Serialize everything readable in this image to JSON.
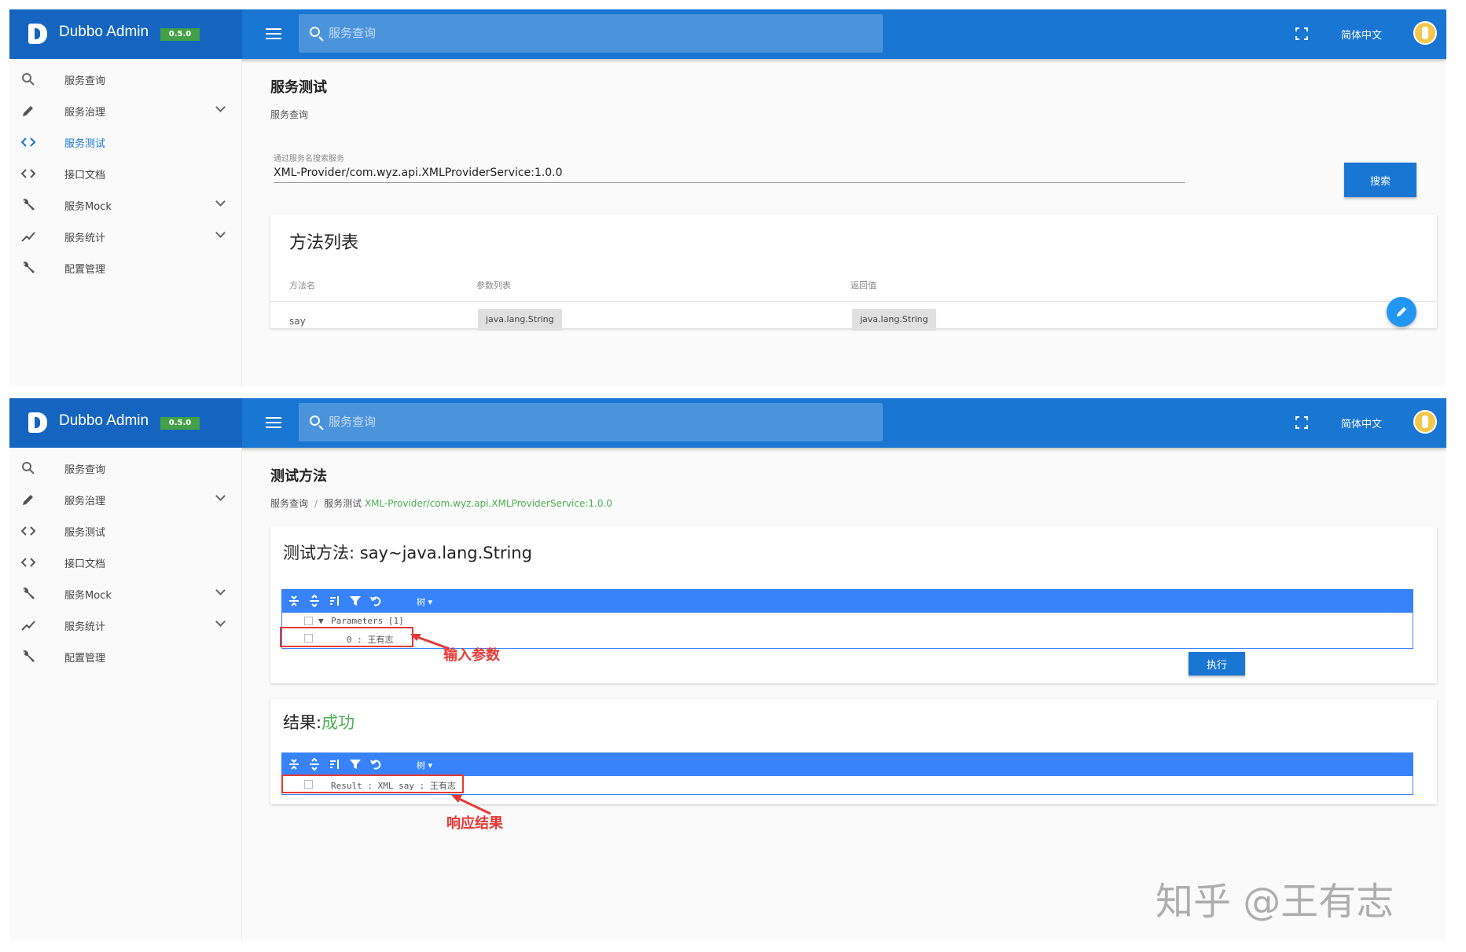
{
  "app": {
    "title": "Dubbo Admin",
    "version": "0.5.0"
  },
  "header": {
    "search_placeholder": "服务查询",
    "language": "简体中文"
  },
  "sidebar": {
    "items": [
      {
        "label": "服务查询",
        "icon": "search-icon",
        "expandable": false
      },
      {
        "label": "服务治理",
        "icon": "pencil-icon",
        "expandable": true
      },
      {
        "label": "服务测试",
        "icon": "code-icon",
        "expandable": false
      },
      {
        "label": "接口文档",
        "icon": "code-icon",
        "expandable": false
      },
      {
        "label": "服务Mock",
        "icon": "wrench-icon",
        "expandable": true
      },
      {
        "label": "服务统计",
        "icon": "trending-icon",
        "expandable": true
      },
      {
        "label": "配置管理",
        "icon": "wrench-icon",
        "expandable": false
      }
    ]
  },
  "screen1": {
    "active_nav": "服务测试",
    "page_title": "服务测试",
    "breadcrumb": "服务查询",
    "search_label": "通过服务名搜索服务",
    "search_value": "XML-Provider/com.wyz.api.XMLProviderService:1.0.0",
    "search_button": "搜索",
    "methods": {
      "title": "方法列表",
      "headers": [
        "方法名",
        "参数列表",
        "返回值"
      ],
      "rows": [
        {
          "name": "say",
          "params": "java.lang.String",
          "return": "java.lang.String"
        }
      ]
    }
  },
  "screen2": {
    "page_title": "测试方法",
    "breadcrumb": {
      "first": "服务查询",
      "separator": "/",
      "second": "服务测试",
      "service": "XML-Provider/com.wyz.api.XMLProviderService:1.0.0"
    },
    "test": {
      "title": "测试方法: say~java.lang.String",
      "mode_label": "树",
      "params_node": "Parameters [1]",
      "param_row": "0 : 王有志",
      "execute_button": "执行",
      "annotation": "输入参数"
    },
    "result": {
      "label": "结果:",
      "status": "成功",
      "row": "Result : XML say : 王有志",
      "annotation": "响应结果"
    }
  },
  "watermark": "知乎 @王有志",
  "colors": {
    "primary": "#1976d2",
    "brand_bar": "#1565c0",
    "version_badge": "#43a047",
    "json_editor": "#3883fa",
    "annotation": "#e53935",
    "success": "#4caf50"
  }
}
